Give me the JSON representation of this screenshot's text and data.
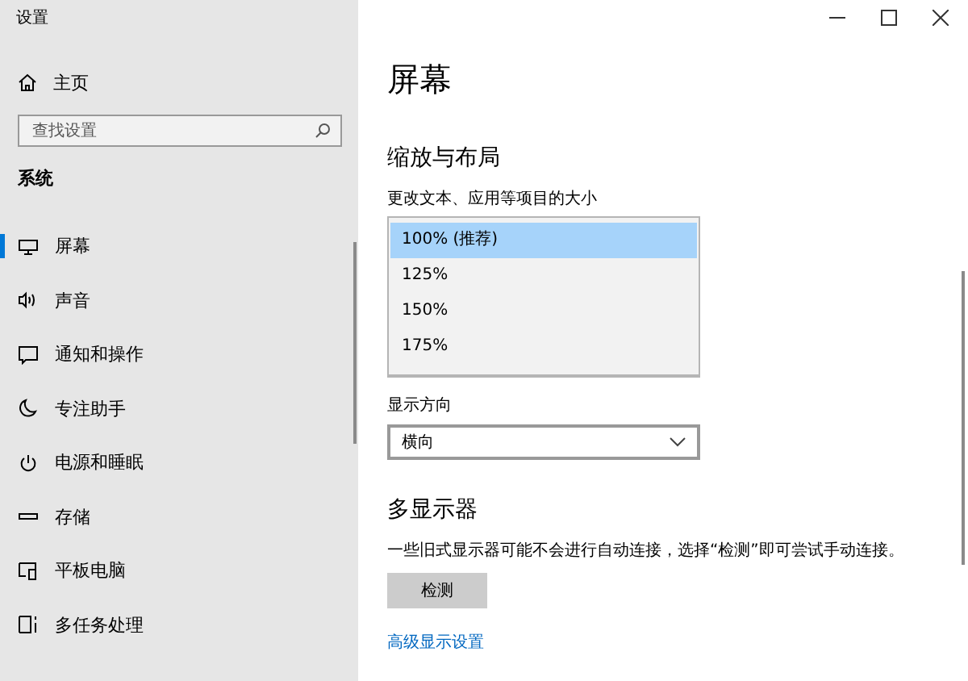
{
  "window": {
    "title": "设置"
  },
  "sidebar": {
    "home": "主页",
    "search": {
      "placeholder": "查找设置"
    },
    "section": "系统",
    "items": [
      {
        "label": "屏幕",
        "kind": "monitor",
        "selected": true
      },
      {
        "label": "声音",
        "kind": "speaker",
        "selected": false
      },
      {
        "label": "通知和操作",
        "kind": "message",
        "selected": false
      },
      {
        "label": "专注助手",
        "kind": "moon",
        "selected": false
      },
      {
        "label": "电源和睡眠",
        "kind": "power",
        "selected": false
      },
      {
        "label": "存储",
        "kind": "storage",
        "selected": false
      },
      {
        "label": "平板电脑",
        "kind": "tablet",
        "selected": false
      },
      {
        "label": "多任务处理",
        "kind": "multitask",
        "selected": false
      }
    ]
  },
  "page": {
    "title": "屏幕",
    "scale_section": "缩放与布局",
    "scale_label": "更改文本、应用等项目的大小",
    "scale_options": [
      {
        "label": "100% (推荐)",
        "selected": true
      },
      {
        "label": "125%",
        "selected": false
      },
      {
        "label": "150%",
        "selected": false
      },
      {
        "label": "175%",
        "selected": false
      }
    ],
    "orientation_label": "显示方向",
    "orientation_value": "横向",
    "multi_section": "多显示器",
    "multi_text": "一些旧式显示器可能不会进行自动连接，选择“检测”即可尝试手动连接。",
    "detect_button": "检测",
    "advanced_link": "高级显示设置"
  }
}
